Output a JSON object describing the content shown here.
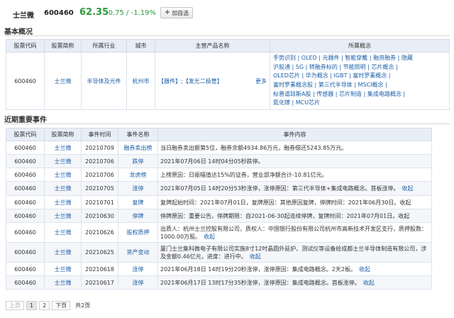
{
  "header": {
    "stock_name": "士兰微",
    "stock_code": "600460",
    "price": "62.35",
    "change": "-0.75 / -1.19%",
    "watch_plus": "+",
    "watch_label": "加自选",
    "price_color": "#2c9a3a"
  },
  "overview": {
    "title": "基本概况",
    "columns": [
      "股票代码",
      "股票简称",
      "所属行业",
      "城市",
      "主营产品名称",
      "所属概念"
    ],
    "row": {
      "code": "600460",
      "name": "士兰微",
      "industry": "半导体及元件",
      "city": "杭州市",
      "products": "【器件】;【发光二极管】",
      "more": "更多",
      "concepts": [
        "手势识别 | OLED | 元器件 | 智能穿戴 | 融资融券 | 隐藏",
        "沪股通 | 5G | 转融券标的 | 节能照明 | 芯片概念 |",
        "OLED芯片 | 华为概念 | IGBT | 富时罗素概念 |",
        "富时罗素概念股 | 第三代半导体 | MSCI概念 |",
        "标普道琼斯A股 | 传感器 | 芯片制造 | 集成电路概念 |",
        "氮化镓 | MCU芯片"
      ]
    }
  },
  "events": {
    "title": "近期重要事件",
    "columns": [
      "股票代码",
      "股票简称",
      "事件时间",
      "事件名称",
      "事件内容"
    ],
    "rows": [
      {
        "code": "600460",
        "name": "士兰微",
        "date": "20210709",
        "event": "融券卖出榜",
        "content": "当日融券卖出额第5位，融券余额4934.86万元，融券偿还5243.85万元。",
        "action": ""
      },
      {
        "code": "600460",
        "name": "士兰微",
        "date": "20210706",
        "event": "跌停",
        "content": "2021年07月06日 14时04分05秒跌停。",
        "action": ""
      },
      {
        "code": "600460",
        "name": "士兰微",
        "date": "20210706",
        "event": "龙虎榜",
        "content": "上榜原因：日振幅值达15%的证券，营业部净额合计-10.81亿元。",
        "action": ""
      },
      {
        "code": "600460",
        "name": "士兰微",
        "date": "20210705",
        "event": "涨停",
        "content": "2021年07月05日 14时20分53秒涨停，涨停原因：第三代半导体+集成电路概念。首板涨停。",
        "action": "收起"
      },
      {
        "code": "600460",
        "name": "士兰微",
        "date": "20210701",
        "event": "复牌",
        "content": "复牌起始时间：2021年07月01日，复牌原因：其他原因复牌，停牌时间：2021年06月30日。收起",
        "action": ""
      },
      {
        "code": "600460",
        "name": "士兰微",
        "date": "20210630",
        "event": "停牌",
        "content": "停牌原因：重要公告，停牌期限：自2021-06-30起连续停牌，复牌时间：2021年07月01日。收起",
        "action": ""
      },
      {
        "code": "600460",
        "name": "士兰微",
        "date": "20210626",
        "event": "股权质押",
        "content": "出质人：杭州士兰控股有限公司，质权人：中国银行股份有限公司杭州市高新技术开发区支行，质押股数：1000.00万股。",
        "action": "收起"
      },
      {
        "code": "600460",
        "name": "士兰微",
        "date": "20210625",
        "event": "资产变动",
        "content": "厦门士兰集科微电子有限公司实施8寸12吋晶圆外延护、测试仪等设备给成都士兰半导体制造有限公司，涉及金额0.46亿元，进度：进行中。",
        "action": "收起"
      },
      {
        "code": "600460",
        "name": "士兰微",
        "date": "20210618",
        "event": "涨停",
        "content": "2021年06月18日 14时19分20秒涨停，涨停原因：集成电路概念。2天2板。",
        "action": "收起"
      },
      {
        "code": "600460",
        "name": "士兰微",
        "date": "20210617",
        "event": "涨停",
        "content": "2021年06月17日 13时17分35秒涨停，涨停原因：集成电路概念。首板涨停。",
        "action": "收起"
      }
    ]
  },
  "pager": {
    "prev": "上页",
    "page1": "1",
    "page2": "2",
    "next": "下页",
    "total": "共2页"
  }
}
